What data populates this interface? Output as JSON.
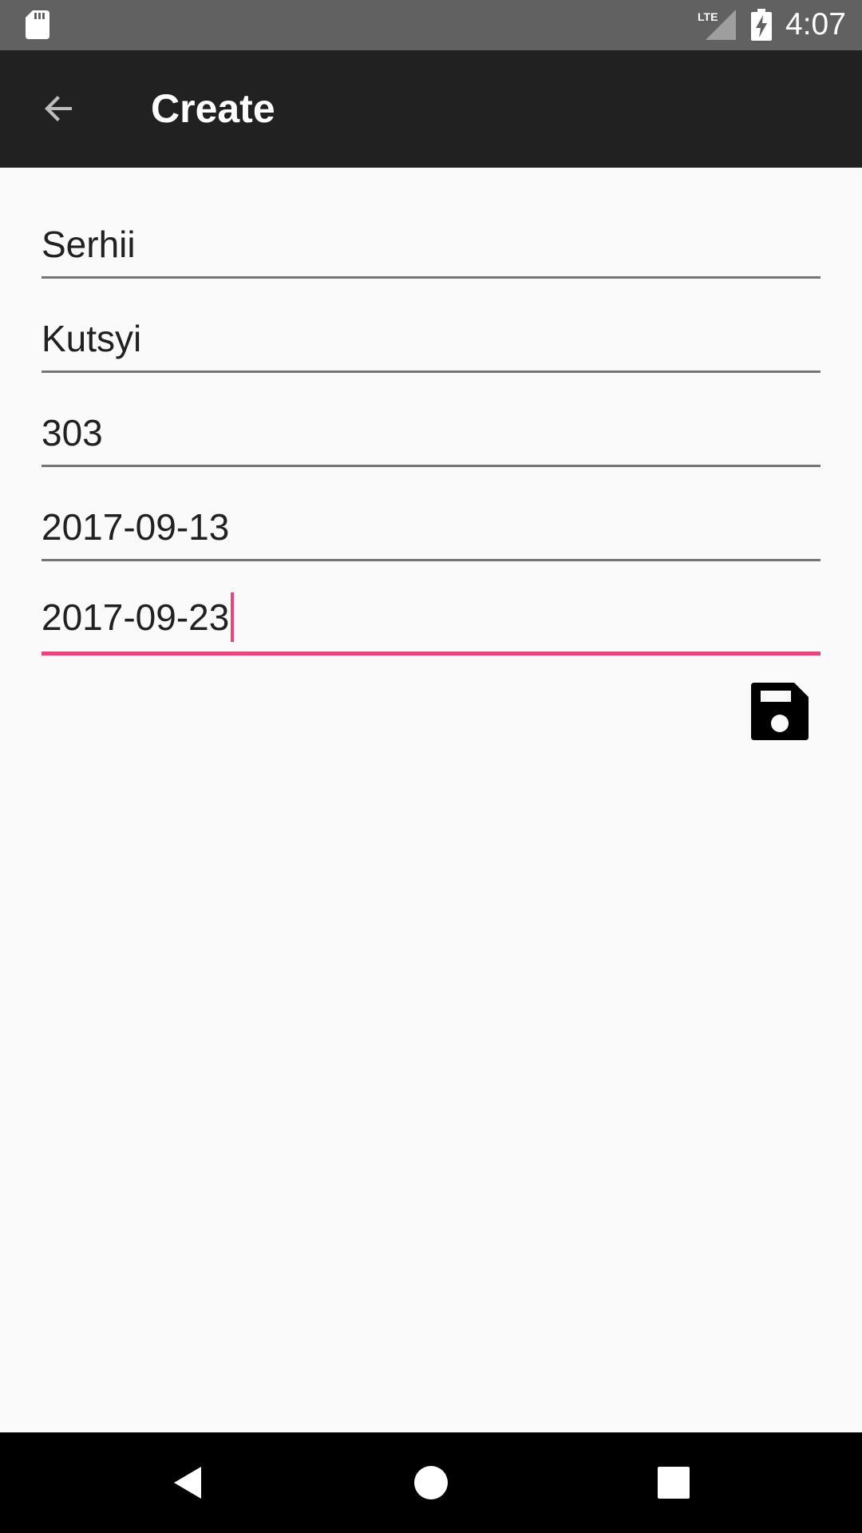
{
  "status_bar": {
    "time": "4:07",
    "network": "LTE",
    "icons": [
      "sd-card-icon",
      "lte-signal-icon",
      "battery-charging-icon"
    ]
  },
  "toolbar": {
    "title": "Create",
    "back_icon": "arrow-back-icon"
  },
  "form": {
    "fields": [
      {
        "value": "Serhii"
      },
      {
        "value": "Kutsyi"
      },
      {
        "value": "303"
      },
      {
        "value": "2017-09-13"
      },
      {
        "value": "2017-09-23",
        "focused": true
      }
    ],
    "save_icon": "floppy-disk-save-icon"
  },
  "colors": {
    "status_bar": "#616161",
    "toolbar": "#212121",
    "background": "#fafafa",
    "accent": "#e8457c",
    "underline": "#757575",
    "nav_bar": "#000000"
  },
  "nav_bar": {
    "icons": [
      "triangle-back-icon",
      "circle-home-icon",
      "square-recents-icon"
    ]
  }
}
